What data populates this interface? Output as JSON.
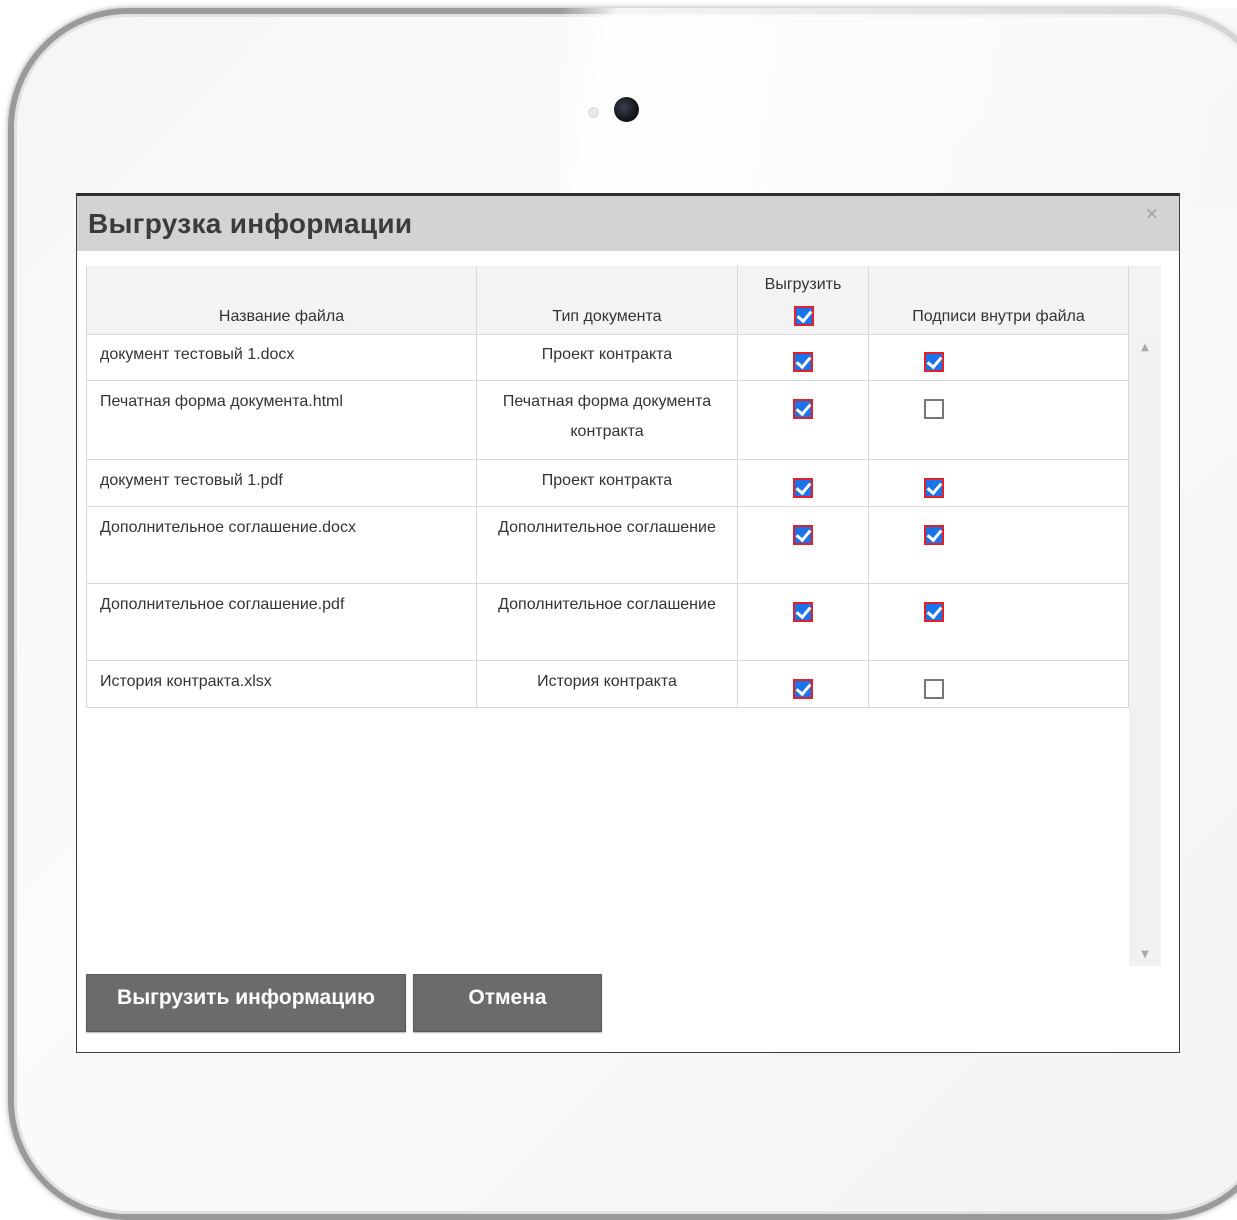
{
  "dialog": {
    "title": "Выгрузка информации",
    "close": "×"
  },
  "table": {
    "columns": {
      "name": "Название файла",
      "type": "Тип документа",
      "export": "Выгрузить",
      "signatures": "Подписи внутри файла"
    },
    "header_export_checked": true,
    "rows": [
      {
        "name": "документ тестовый 1.docx",
        "type": "Проект контракта",
        "export": true,
        "signatures": true
      },
      {
        "name": "Печатная форма документа.html",
        "type": "Печатная форма документа контракта",
        "export": true,
        "signatures": false
      },
      {
        "name": "документ тестовый 1.pdf",
        "type": "Проект контракта",
        "export": true,
        "signatures": true
      },
      {
        "name": "Дополнительное соглашение.docx",
        "type": "Дополнительное соглашение",
        "export": true,
        "signatures": true
      },
      {
        "name": "Дополнительное соглашение.pdf",
        "type": "Дополнительное соглашение",
        "export": true,
        "signatures": true
      },
      {
        "name": "История контракта.xlsx",
        "type": "История контракта",
        "export": true,
        "signatures": false
      }
    ]
  },
  "buttons": {
    "export": "Выгрузить информацию",
    "cancel": "Отмена"
  },
  "scrollbar": {
    "up": "▲",
    "down": "▼"
  }
}
